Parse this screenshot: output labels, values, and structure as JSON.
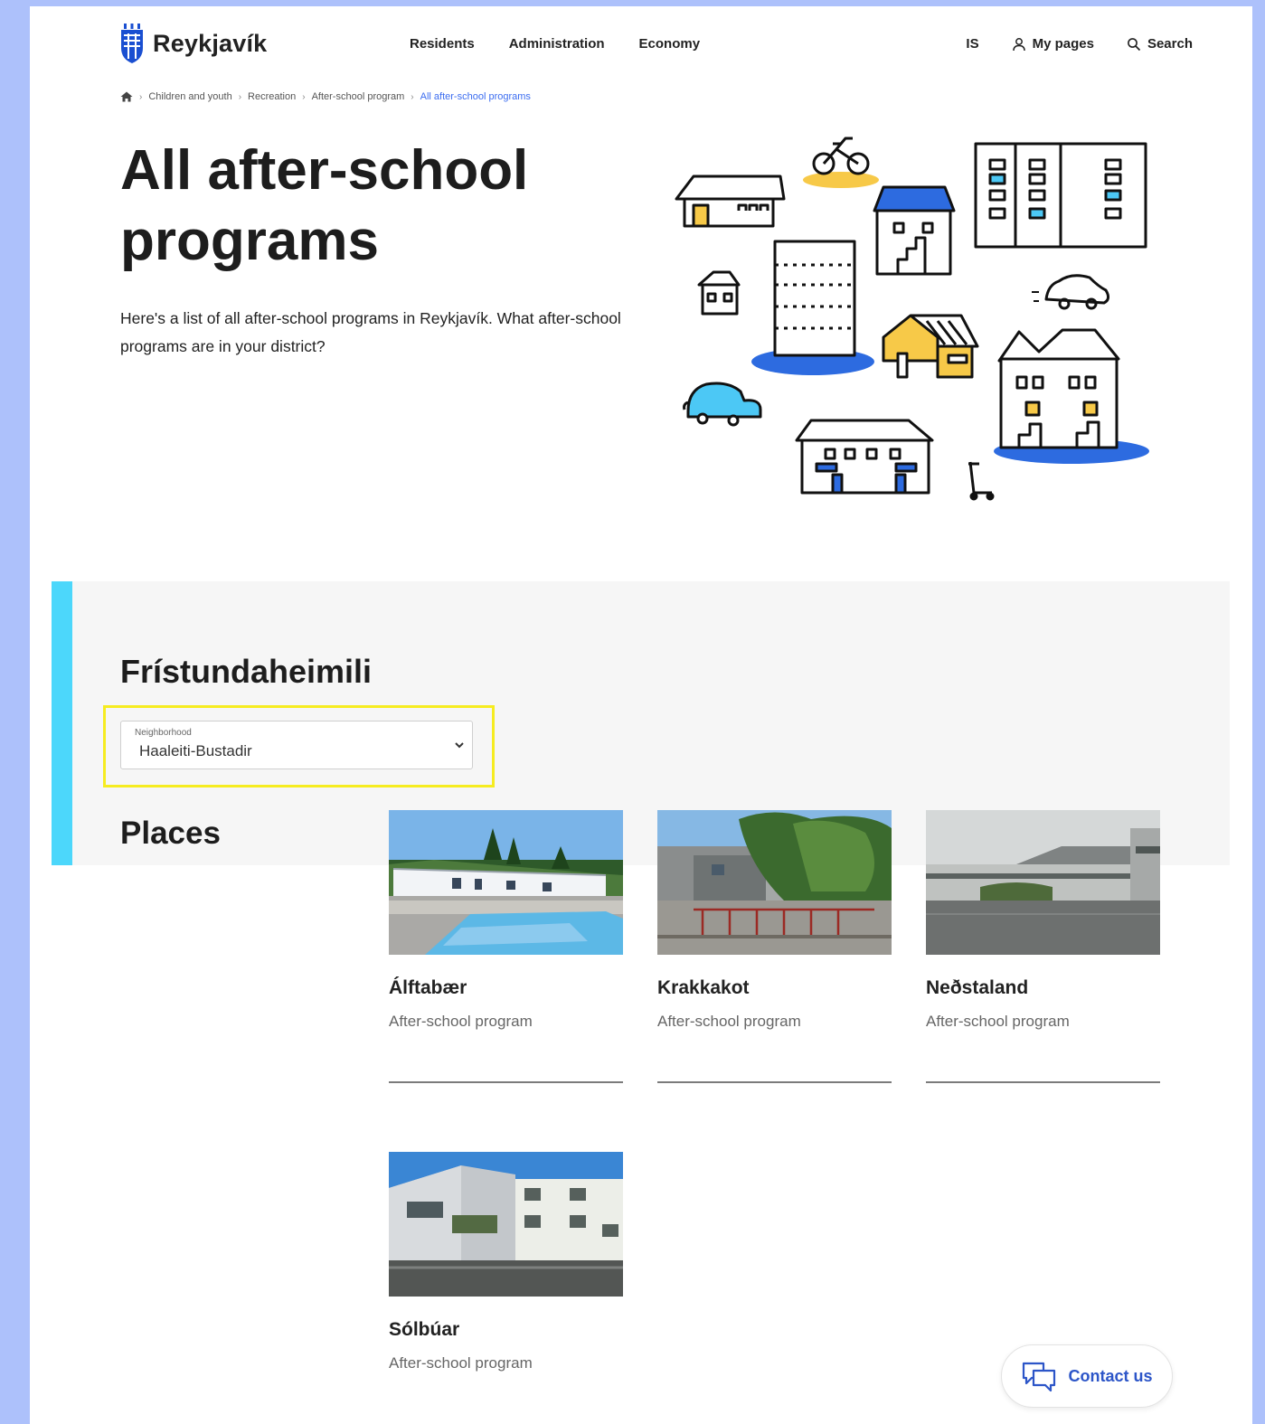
{
  "header": {
    "logo_text": "Reykjavík",
    "nav": [
      "Residents",
      "Administration",
      "Economy"
    ],
    "language": "IS",
    "my_pages": "My pages",
    "search": "Search"
  },
  "breadcrumb": {
    "items": [
      "Children and youth",
      "Recreation",
      "After-school program"
    ],
    "current": "All after-school programs"
  },
  "hero": {
    "title": "All after-school programs",
    "text": "Here's a list of all after-school programs in Reykjavík. What after-school programs are in your district?"
  },
  "section": {
    "title": "Frístundaheimili",
    "select_label": "Neighborhood",
    "select_value": "Haaleiti-Bustadir",
    "places_title": "Places"
  },
  "places": [
    {
      "name": "Álftabær",
      "type": "After-school program"
    },
    {
      "name": "Krakkakot",
      "type": "After-school program"
    },
    {
      "name": "Neðstaland",
      "type": "After-school program"
    },
    {
      "name": "Sólbúar",
      "type": "After-school program"
    }
  ],
  "contact": {
    "label": "Contact us"
  },
  "colors": {
    "page_border": "#adc1fb",
    "accent_bar": "#4cd7fb",
    "highlight": "#f6ec20",
    "link_blue": "#3c6df0",
    "contact_blue": "#2c55c8"
  }
}
